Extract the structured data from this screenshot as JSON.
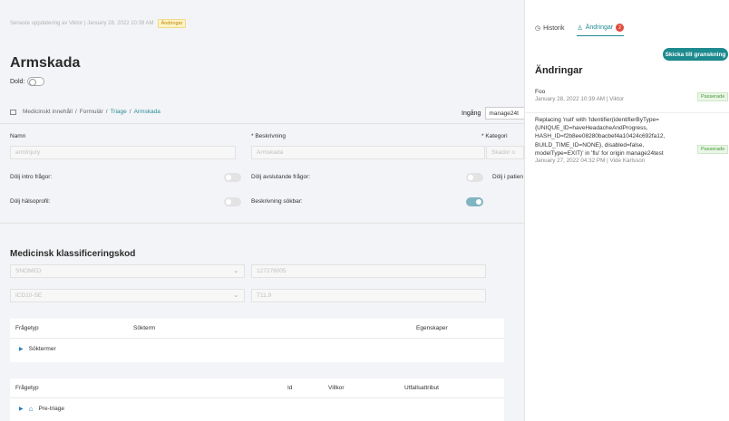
{
  "header": {
    "last_updated": "Senaste uppdatering av Viktor | January 28, 2022 10:39 AM",
    "changes_badge": "Ändringar",
    "title": "Armskada",
    "hidden_label": "Dold:"
  },
  "breadcrumb": {
    "items": [
      "Medicinskt innehåll",
      "/",
      "Formulär",
      "/",
      "Triage",
      "/",
      "Armskada"
    ]
  },
  "ingang": {
    "label": "Ingång",
    "value": "manage24t"
  },
  "form": {
    "name_label": "Namn",
    "name_value": "armInjury",
    "description_label": "* Beskrivning",
    "description_value": "Armskada",
    "category_label": "* Kategori",
    "category_value": "Skador o",
    "hide_intro": "Dölj intro frågor:",
    "hide_final": "Dölj avslutande frågor:",
    "hide_patient": "Dölj i patien",
    "hide_health": "Dölj hälsoprofil:",
    "desc_searchable": "Beskrivning sökbar:"
  },
  "classification": {
    "heading": "Medicinsk klassificeringskod",
    "rows": [
      {
        "system": "SNOMED",
        "code": "127278005"
      },
      {
        "system": "ICD10-SE",
        "code": "T11.9"
      }
    ]
  },
  "table1": {
    "headers": [
      "Frågetyp",
      "Sökterm",
      "Egenskaper"
    ],
    "row": "Söktermer"
  },
  "table2": {
    "headers": [
      "Frågetyp",
      "Id",
      "Villkor",
      "Utfallsattribut"
    ],
    "row": "Pre-triage"
  },
  "panel": {
    "tab_history": "Historik",
    "tab_changes": "Ändringar",
    "changes_count": "2",
    "send_button": "Skicka till granskning",
    "heading": "Ändringar",
    "changes": [
      {
        "text": "Foo",
        "meta": "January 28, 2022 10:39 AM | Viktor",
        "status": "Passerade"
      },
      {
        "text_parts": [
          "Replacing 'null' with 'Identifier(identifierByType=",
          "{UNIQUE_ID=haveHeadacheAndProgress,",
          "HASH_ID=f2b8ee08280bacbef4a10424c692fa12,",
          "BUILD_TIME_ID=NONE}, disabled=false,",
          "modelType=EXIT)' in 'flu' for origin manage24test"
        ],
        "meta": "January 27, 2022 04:32 PM | Vide Karlsson",
        "status": "Passerade"
      }
    ]
  },
  "colors": {
    "accent": "#1c8a8e",
    "badge_red": "#e04b3c",
    "passed_green": "#4b9a3c",
    "warning_yellow": "#fff3c4"
  }
}
